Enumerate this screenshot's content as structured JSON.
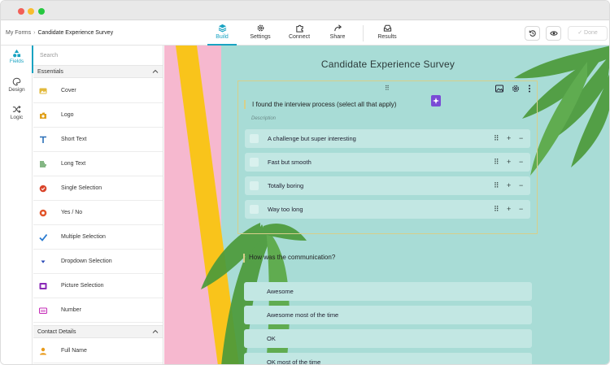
{
  "breadcrumb": {
    "root": "My Forms",
    "separator": "›",
    "current": "Candidate Experience Survey"
  },
  "tabs": [
    {
      "label": "Build",
      "icon": "layers-icon",
      "active": true
    },
    {
      "label": "Settings",
      "icon": "gear-icon",
      "active": false
    },
    {
      "label": "Connect",
      "icon": "puzzle-icon",
      "active": false
    },
    {
      "label": "Share",
      "icon": "share-arrow-icon",
      "active": false
    },
    {
      "label": "Results",
      "icon": "inbox-icon",
      "active": false
    }
  ],
  "toolbar": {
    "done_label": "Done",
    "history_icon": "history-icon",
    "preview_icon": "eye-icon"
  },
  "rail": [
    {
      "label": "Fields",
      "icon": "shapes-icon",
      "active": true
    },
    {
      "label": "Design",
      "icon": "palette-icon",
      "active": false
    },
    {
      "label": "Logic",
      "icon": "shuffle-icon",
      "active": false
    }
  ],
  "panel": {
    "search_placeholder": "Search",
    "sections": [
      {
        "title": "Essentials",
        "items": [
          {
            "label": "Cover",
            "icon": "cover-icon",
            "color": "#e2b93b"
          },
          {
            "label": "Logo",
            "icon": "logo-icon",
            "color": "#e0a11c"
          },
          {
            "label": "Short Text",
            "icon": "text-t-icon",
            "color": "#2a6fb7"
          },
          {
            "label": "Long Text",
            "icon": "paragraph-icon",
            "color": "#3a8a3a"
          },
          {
            "label": "Single Selection",
            "icon": "radio-check-icon",
            "color": "#d9452b"
          },
          {
            "label": "Yes / No",
            "icon": "yes-no-icon",
            "color": "#e2552b"
          },
          {
            "label": "Multiple Selection",
            "icon": "checkmark-icon",
            "color": "#2a7bd1"
          },
          {
            "label": "Dropdown Selection",
            "icon": "dropdown-caret-icon",
            "color": "#2a4ab7"
          },
          {
            "label": "Picture Selection",
            "icon": "picture-icon",
            "color": "#8a2ab7"
          },
          {
            "label": "Number",
            "icon": "number-icon",
            "color": "#c42ab7"
          }
        ]
      },
      {
        "title": "Contact Details",
        "items": [
          {
            "label": "Full Name",
            "icon": "person-icon",
            "color": "#e89b1c"
          }
        ]
      }
    ]
  },
  "form": {
    "title": "Candidate Experience Survey",
    "question1": {
      "title": "I found the interview process (select all that apply)",
      "description": "Description",
      "options": [
        "A challenge but super interesting",
        "Fast but smooth",
        "Totally boring",
        "Way too long"
      ]
    },
    "question2": {
      "title": "How was the communication?",
      "options": [
        "Awesome",
        "Awesome most of the time",
        "OK",
        "OK most of the time"
      ]
    }
  },
  "colors": {
    "accent": "#19a3c2",
    "canvas_background": "#a8dcd6",
    "stripe_yellow": "#f9c41b",
    "stripe_pink": "#f6b8cf",
    "ai_badge": "#7a4bd6"
  }
}
